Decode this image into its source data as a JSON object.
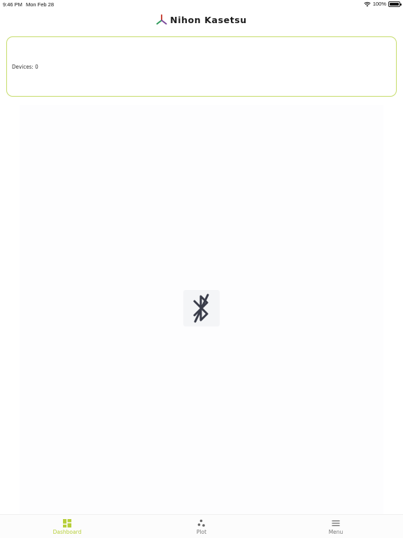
{
  "status_bar": {
    "time": "9:46 PM",
    "date": "Mon Feb 28",
    "battery": "100%",
    "icons": [
      "wifi-icon",
      "battery-icon"
    ]
  },
  "header": {
    "title": "Nihon Kasetsu",
    "logo": "tripod-logo"
  },
  "devices_card": {
    "label": "Devices: 0"
  },
  "center_icon": "bluetooth-disabled-icon",
  "tab_bar": {
    "tabs": [
      {
        "label": "Dashboard",
        "icon": "dashboard-grid-icon",
        "active": true
      },
      {
        "label": "Plot",
        "icon": "plot-dots-icon",
        "active": false
      },
      {
        "label": "Menu",
        "icon": "hamburger-menu-icon",
        "active": false
      }
    ]
  },
  "colors": {
    "accent": "#b7cf3a",
    "card_border": "#c6dc6a",
    "logo_red": "#c9473a",
    "logo_green": "#2f9a5a",
    "logo_purple": "#7b4a9a"
  }
}
